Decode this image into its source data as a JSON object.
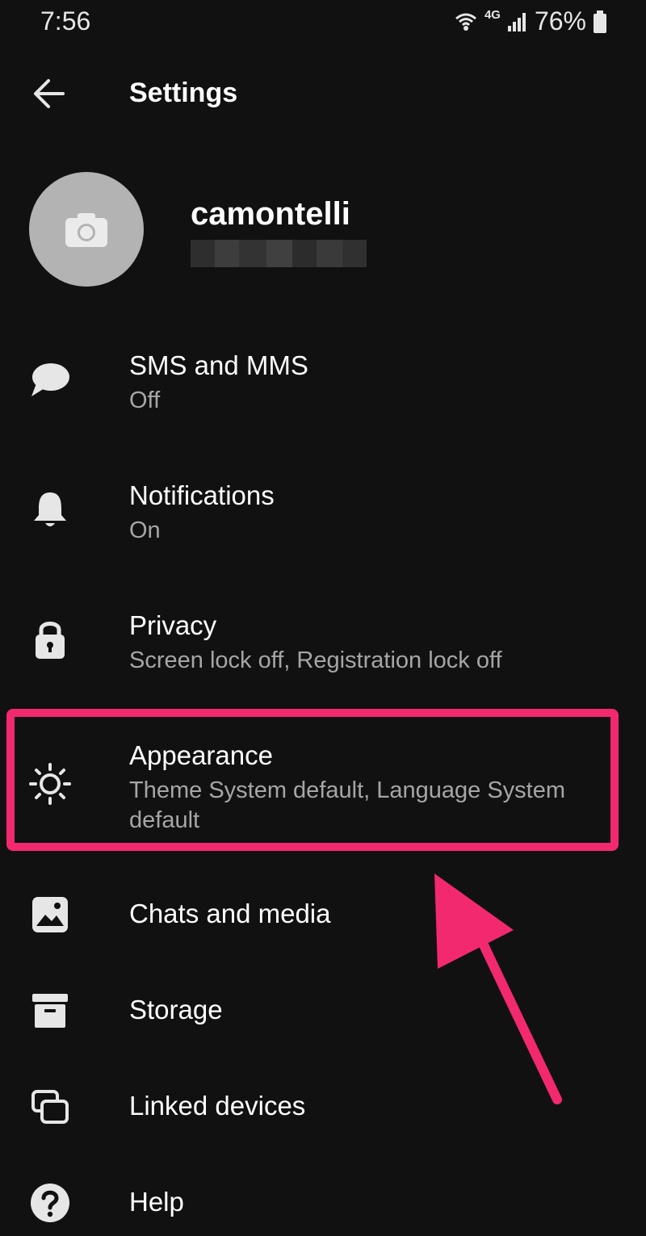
{
  "status_bar": {
    "time": "7:56",
    "network": "4G",
    "battery": "76%"
  },
  "app_bar": {
    "title": "Settings"
  },
  "profile": {
    "name": "camontelli"
  },
  "items": [
    {
      "title": "SMS and MMS",
      "subtitle": "Off",
      "icon": "chat-bubble-icon"
    },
    {
      "title": "Notifications",
      "subtitle": "On",
      "icon": "bell-icon"
    },
    {
      "title": "Privacy",
      "subtitle": "Screen lock off, Registration lock off",
      "icon": "lock-icon"
    },
    {
      "title": "Appearance",
      "subtitle": "Theme System default, Language System default",
      "icon": "sun-icon"
    },
    {
      "title": "Chats and media",
      "icon": "image-icon"
    },
    {
      "title": "Storage",
      "icon": "archive-box-icon"
    },
    {
      "title": "Linked devices",
      "icon": "linked-devices-icon"
    },
    {
      "title": "Help",
      "icon": "help-icon"
    }
  ],
  "colors": {
    "background": "#111111",
    "highlight": "#f2296f",
    "subtitle": "#a6a6a6",
    "avatar": "#b3b3b3"
  }
}
